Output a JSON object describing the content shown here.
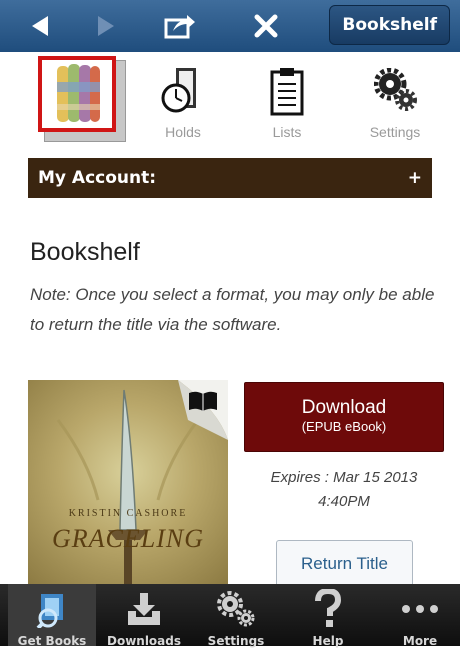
{
  "topbar": {
    "bookshelf_label": "Bookshelf"
  },
  "icons": {
    "holds": "Holds",
    "lists": "Lists",
    "settings": "Settings"
  },
  "account": {
    "label": "My Account:",
    "expand": "+"
  },
  "main": {
    "title": "Bookshelf",
    "note": "Note: Once you select a format, you may only be able to return the title via the software."
  },
  "book": {
    "author": "KRISTIN CASHORE",
    "title": "GRACELING",
    "download_label": "Download",
    "download_format": "(EPUB eBook)",
    "expires_line1": "Expires :  Mar 15 2013",
    "expires_line2": "4:40PM",
    "return_label": "Return Title"
  },
  "tabbar": {
    "get_books": "Get Books",
    "downloads": "Downloads",
    "settings": "Settings",
    "help": "Help",
    "more": "More"
  }
}
